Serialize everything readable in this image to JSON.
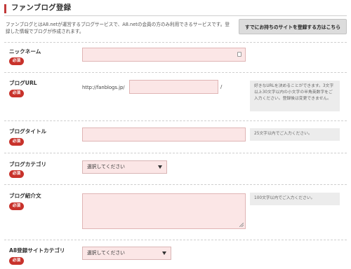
{
  "header": {
    "title": "ファンブログ登録"
  },
  "intro": {
    "text": "ファンブログとはA8.netが運営するブログサービスで、A8.netの会員の方のみ利用できるサービスです。登録した情報でブログが作成されます。"
  },
  "existing_site_button": {
    "label": "すでにお持ちのサイトを登録する方はこちら"
  },
  "required_badge": "必須",
  "fields": {
    "nickname": {
      "label": "ニックネーム",
      "value": ""
    },
    "blog_url": {
      "label": "ブログURL",
      "prefix": "http://fanblogs.jp/",
      "suffix": "/",
      "value": "",
      "note": "好きなURLを決めることができます。3文字以上30文字以内の小文字の半角英数字をご入力ください。登録後は変更できません。"
    },
    "blog_title": {
      "label": "ブログタイトル",
      "value": "",
      "note": "25文字以内でご入力ください。"
    },
    "blog_category": {
      "label": "ブログカテゴリ",
      "selected": "選択してください"
    },
    "blog_intro": {
      "label": "ブログ紹介文",
      "value": "",
      "note": "100文字以内でご入力ください。"
    },
    "a8_site_category": {
      "label": "A8登録サイトカテゴリ",
      "selected": "選択してください"
    }
  },
  "colors": {
    "accent": "#c23a3a",
    "required": "#c8322b",
    "input_bg": "#fbe6e6",
    "note_bg": "#ececec"
  }
}
